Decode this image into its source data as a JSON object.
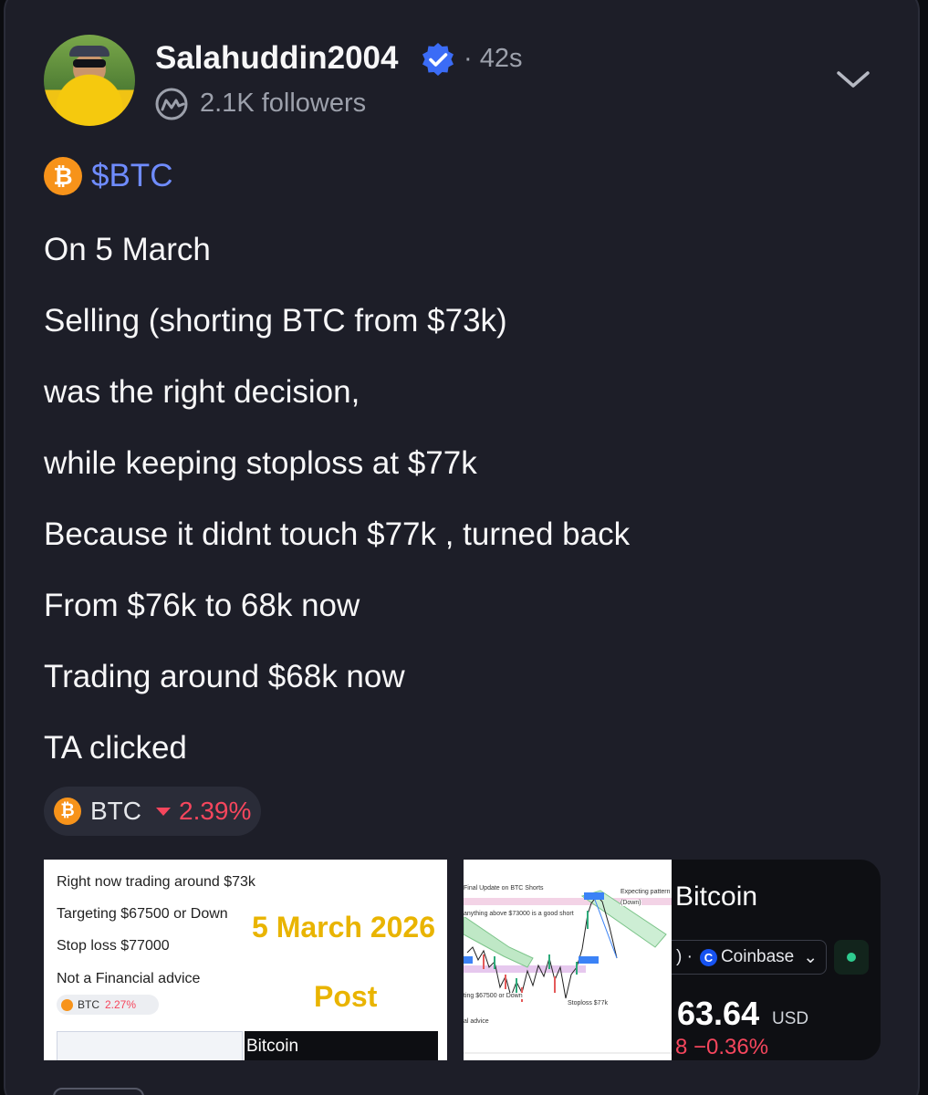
{
  "author": {
    "username": "Salahuddin2004",
    "time_ago": "· 42s",
    "followers": "2.1K followers"
  },
  "post": {
    "ticker": "$BTC",
    "lines": [
      "On 5 March",
      "Selling (shorting BTC from $73k)",
      "was the right decision,",
      "while keeping stoploss at $77k",
      "Because it didnt touch $77k , turned back",
      "From $76k to 68k now",
      "Trading around $68k now",
      "TA clicked"
    ]
  },
  "coin_pill": {
    "symbol": "BTC",
    "change": "2.39%"
  },
  "attachments": {
    "image1": {
      "lines": [
        "Right now trading around $73k",
        "Targeting $67500 or Down",
        "Stop loss $77000",
        "Not a Financial advice"
      ],
      "pill_symbol": "BTC",
      "pill_change": "2.27%",
      "date": "5 March 2026",
      "post_word": "Post",
      "thumb_title": "Bitcoin"
    },
    "image2": {
      "labels": [
        "Final Update on BTC Shorts",
        "anything above $73000 is a good short",
        "Expecting pattern",
        "(Down)",
        "ting $67500 or Down",
        "Stoploss $77k",
        "al advice"
      ]
    },
    "image3": {
      "title": "Bitcoin",
      "exchange_prefix": ") ·",
      "exchange": "Coinbase",
      "exchange_chevron": "⌄",
      "price": "63.64",
      "currency": "USD",
      "change": "8 −0.36%"
    }
  },
  "colors": {
    "card_bg": "#1d1e28",
    "link_blue": "#6f8cff",
    "down_red": "#f6465d",
    "btc_orange": "#f7931a",
    "highlight_yellow": "#e9b400"
  },
  "icons": [
    "verified-badge-icon",
    "coinmarketcap-icon",
    "chevron-down-icon",
    "bitcoin-icon",
    "down-triangle-icon",
    "coinbase-icon"
  ]
}
